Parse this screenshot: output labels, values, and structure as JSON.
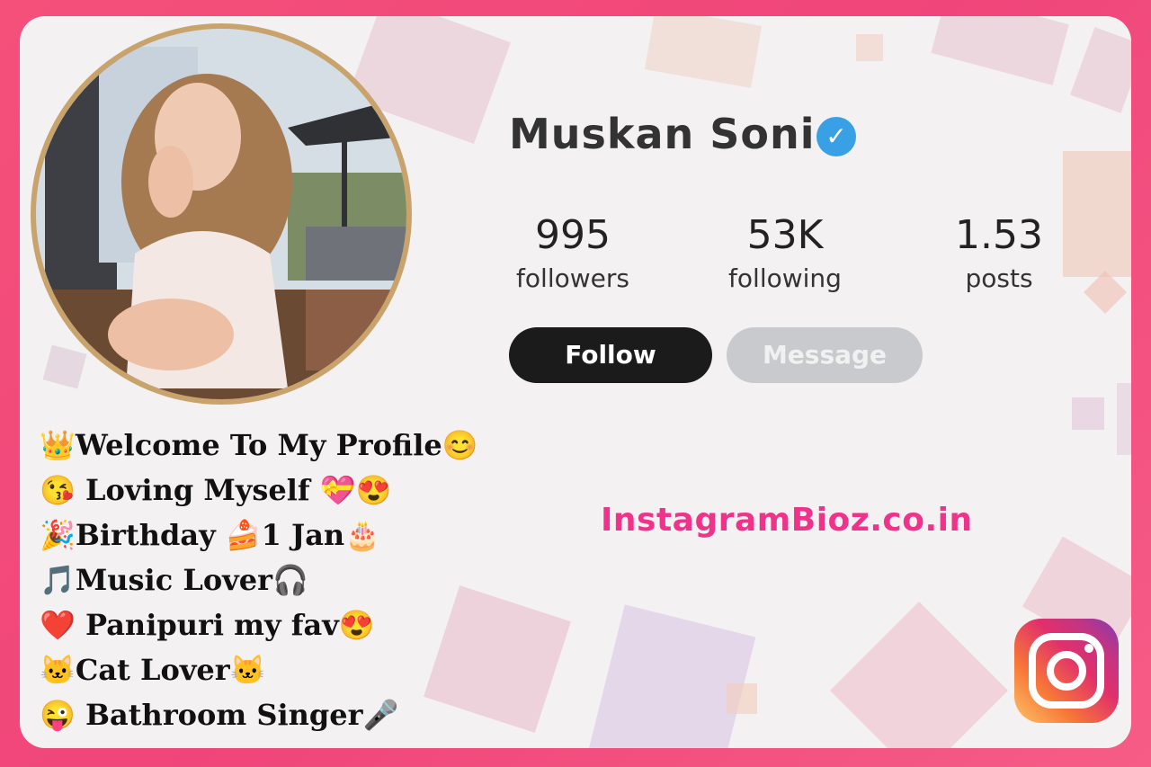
{
  "profile": {
    "name": "Muskan Soni",
    "verified_icon": "verified-checkmark-icon",
    "avatar_desc_icon": "profile-photo"
  },
  "stats": [
    {
      "value": "995",
      "label": "followers"
    },
    {
      "value": "53K",
      "label": "following"
    },
    {
      "value": "1.53",
      "label": "posts"
    }
  ],
  "actions": {
    "follow_label": "Follow",
    "message_label": "Message"
  },
  "bio": [
    "👑Welcome To My Profile😊",
    "😘 Loving Myself 💝😍",
    "🎉Birthday 🍰1 Jan🎂",
    "🎵Music Lover🎧",
    "❤️ Panipuri my fav😍",
    "🐱Cat Lover🐱",
    "😜 Bathroom Singer🎤"
  ],
  "website": "InstagramBioz.co.in",
  "colors": {
    "frame": "#f4507a",
    "follow_button": "#1c1b1c",
    "message_button": "#c9cacd",
    "website_text": "#f0338a",
    "verified_badge": "#3aa0e6"
  },
  "logo": "instagram-logo-icon"
}
